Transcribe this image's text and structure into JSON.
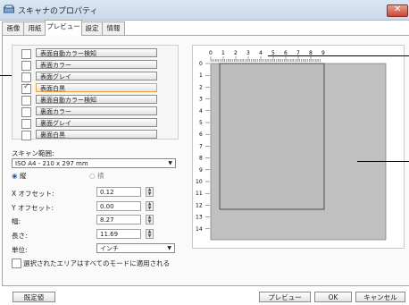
{
  "window": {
    "title": "スキャナのプロパティ"
  },
  "tabs": [
    {
      "label": "画像"
    },
    {
      "label": "用紙"
    },
    {
      "label": "プレビュー"
    },
    {
      "label": "設定"
    },
    {
      "label": "情報"
    }
  ],
  "image_options": [
    {
      "label": "表面自動カラー検知",
      "checked": false
    },
    {
      "label": "表面カラー",
      "checked": false
    },
    {
      "label": "表面グレイ",
      "checked": false
    },
    {
      "label": "表面白黒",
      "checked": true
    },
    {
      "label": "裏面自動カラー検知",
      "checked": false
    },
    {
      "label": "裏面カラー",
      "checked": false
    },
    {
      "label": "裏面グレイ",
      "checked": false
    },
    {
      "label": "裏面白黒",
      "checked": false
    }
  ],
  "scan_area": {
    "label": "スキャン範囲:",
    "value": "ISO A4 - 210 x 297 mm",
    "orientation_portrait": "縦",
    "orientation_landscape": "横"
  },
  "fields": {
    "x_offset": {
      "label": "X オフセット:",
      "value": "0.12"
    },
    "y_offset": {
      "label": "Y オフセット:",
      "value": "0.00"
    },
    "width": {
      "label": "幅:",
      "value": "8.27"
    },
    "length": {
      "label": "長さ:",
      "value": "11.69"
    },
    "unit": {
      "label": "単位:",
      "value": "インチ"
    }
  },
  "apply_all_label": "選択されたエリアはすべてのモードに適用される",
  "ruler": {
    "h_labels": [
      "0",
      "1",
      "2",
      "3",
      "4",
      "5",
      "6",
      "7",
      "8",
      "9"
    ],
    "v_labels": [
      "0",
      "1",
      "2",
      "3",
      "4",
      "5",
      "6",
      "7",
      "8",
      "9",
      "10",
      "11",
      "12",
      "13",
      "14"
    ]
  },
  "buttons": {
    "default": "既定値",
    "preview": "プレビュー",
    "ok": "OK",
    "cancel": "キャンセル"
  }
}
